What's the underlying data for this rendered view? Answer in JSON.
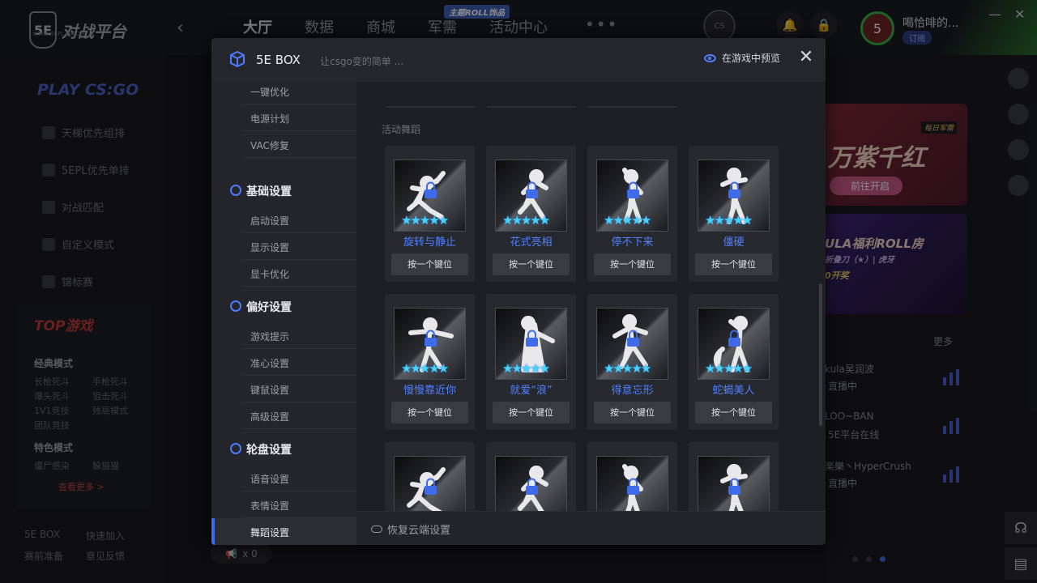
{
  "app": {
    "logo_text": "对战平台",
    "logo_badge": "5E",
    "logo_sub": "WWW.5EPLAY.COM",
    "nav": [
      "大厅",
      "数据",
      "商城",
      "军需",
      "活动中心"
    ],
    "nav_badge": "主题ROLL饰品",
    "nav_more": "•••",
    "emblem": "CS",
    "username": "喝恰啡的...",
    "subscribe": "订阅",
    "avatar_letter": "5"
  },
  "sidebar": {
    "play": "PLAY CS:GO",
    "items": [
      "天梯优先组排",
      "5EPL优先单排",
      "对战匹配",
      "自定义模式",
      "锦标赛"
    ],
    "top_logo": "TOP游戏",
    "classic_mode": "经典模式",
    "classic_links": [
      "长枪死斗",
      "手枪死斗",
      "爆头死斗",
      "狙击死斗",
      "1V1竞技",
      "残局模式",
      "团队竞技"
    ],
    "special_mode": "特色模式",
    "special_links": [
      "僵尸感染",
      "躲猫猫"
    ],
    "see_more": "查看更多 >",
    "footer_links": [
      "5E BOX",
      "快速加入",
      "赛前准备",
      "意见反馈"
    ]
  },
  "right": {
    "promo1_title": "万紫千红",
    "promo1_tag": "每日军需",
    "promo1_btn": "前往开启",
    "promo2_title": "ULA福利ROLL房",
    "promo2_sub": "折叠刀（★）| 虎牙",
    "promo2_prize": "0开奖",
    "more": "更多",
    "streams": [
      {
        "name": "kula吴润波",
        "status": "直播中"
      },
      {
        "name": "LOO~BAN",
        "status": "5E平台在线"
      },
      {
        "name": "楽樂丶HyperCrush",
        "status": "直播中"
      }
    ]
  },
  "horn": "x 0",
  "modal": {
    "title": "5E BOX",
    "subtitle": "让csgo变的简单 ...",
    "preview": "在游戏中预览",
    "close": "✕",
    "nav": {
      "top_items": [
        "一键优化",
        "电源计划",
        "VAC修复"
      ],
      "basic": "基础设置",
      "basic_items": [
        "启动设置",
        "显示设置",
        "显卡优化"
      ],
      "pref": "偏好设置",
      "pref_items": [
        "游戏提示",
        "准心设置",
        "键鼠设置",
        "高级设置"
      ],
      "wheel": "轮盘设置",
      "wheel_items": [
        "语音设置",
        "表情设置",
        "舞蹈设置"
      ]
    },
    "section": "活动舞蹈",
    "stars": "★★★★★",
    "key_label": "按一个键位",
    "dances": [
      "旋转与静止",
      "花式亮相",
      "停不下来",
      "僵硬",
      "慢慢靠近你",
      "就爱“浪”",
      "得意忘形",
      "蛇蝎美人",
      "",
      "",
      "",
      ""
    ],
    "footer": "恢复云端设置"
  }
}
